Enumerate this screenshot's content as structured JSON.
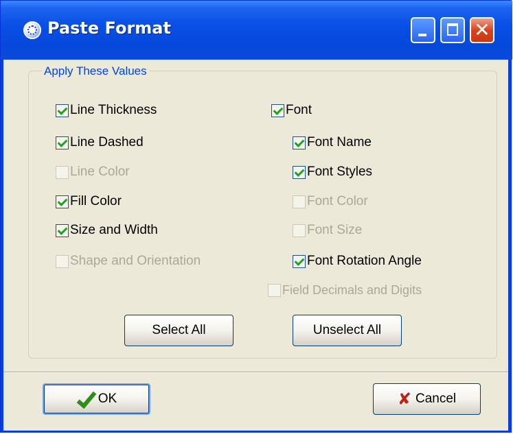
{
  "window": {
    "title": "Paste Format",
    "close_glyph": "✕"
  },
  "group": {
    "title": "Apply These Values"
  },
  "left_options": [
    {
      "label": "Line Thickness",
      "checked": true,
      "enabled": true
    },
    {
      "label": "Line Dashed",
      "checked": true,
      "enabled": true
    },
    {
      "label": "Line Color",
      "checked": false,
      "enabled": false
    },
    {
      "label": "Fill Color",
      "checked": true,
      "enabled": true
    },
    {
      "label": "Size and Width",
      "checked": true,
      "enabled": true
    },
    {
      "label": "Shape and Orientation",
      "checked": false,
      "enabled": false
    }
  ],
  "right_options": [
    {
      "label": "Font",
      "checked": true,
      "enabled": true
    },
    {
      "label": "Font Name",
      "checked": true,
      "enabled": true
    },
    {
      "label": "Font Styles",
      "checked": true,
      "enabled": true
    },
    {
      "label": "Font Color",
      "checked": false,
      "enabled": false
    },
    {
      "label": "Font Size",
      "checked": false,
      "enabled": false
    },
    {
      "label": "Font Rotation Angle",
      "checked": true,
      "enabled": true
    },
    {
      "label": "Field Decimals and Digits",
      "checked": false,
      "enabled": false
    }
  ],
  "buttons": {
    "select_all": "Select All",
    "unselect_all": "Unselect All",
    "ok": "OK",
    "cancel": "Cancel",
    "cancel_glyph": "✘"
  },
  "colors": {
    "titlebar": "#0a50e6",
    "dialog_bg": "#ece9d8",
    "group_title": "#0046d5",
    "disabled_text": "#aca899",
    "check": "#21a121"
  }
}
